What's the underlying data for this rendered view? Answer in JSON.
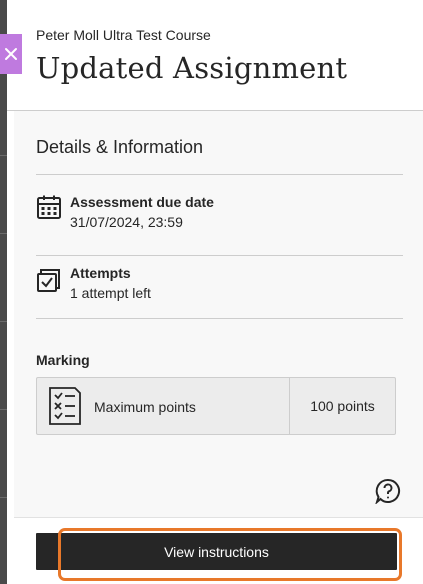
{
  "header": {
    "course_name": "Peter Moll Ultra Test Course",
    "title": "Updated Assignment",
    "close_icon": "close-icon"
  },
  "details": {
    "section_title": "Details & Information",
    "due_date": {
      "icon": "calendar-icon",
      "label": "Assessment due date",
      "value": "31/07/2024, 23:59"
    },
    "attempts": {
      "icon": "attempts-icon",
      "label": "Attempts",
      "value": "1 attempt left"
    }
  },
  "marking": {
    "heading": "Marking",
    "icon": "checklist-icon",
    "label": "Maximum points",
    "value": "100 points"
  },
  "help": {
    "icon": "help-icon"
  },
  "footer": {
    "primary_button": "View instructions"
  },
  "colors": {
    "accent_close": "#bf7adf",
    "primary_button": "#262626",
    "highlight": "#e8782a",
    "content_bg": "#f8f8f8"
  }
}
